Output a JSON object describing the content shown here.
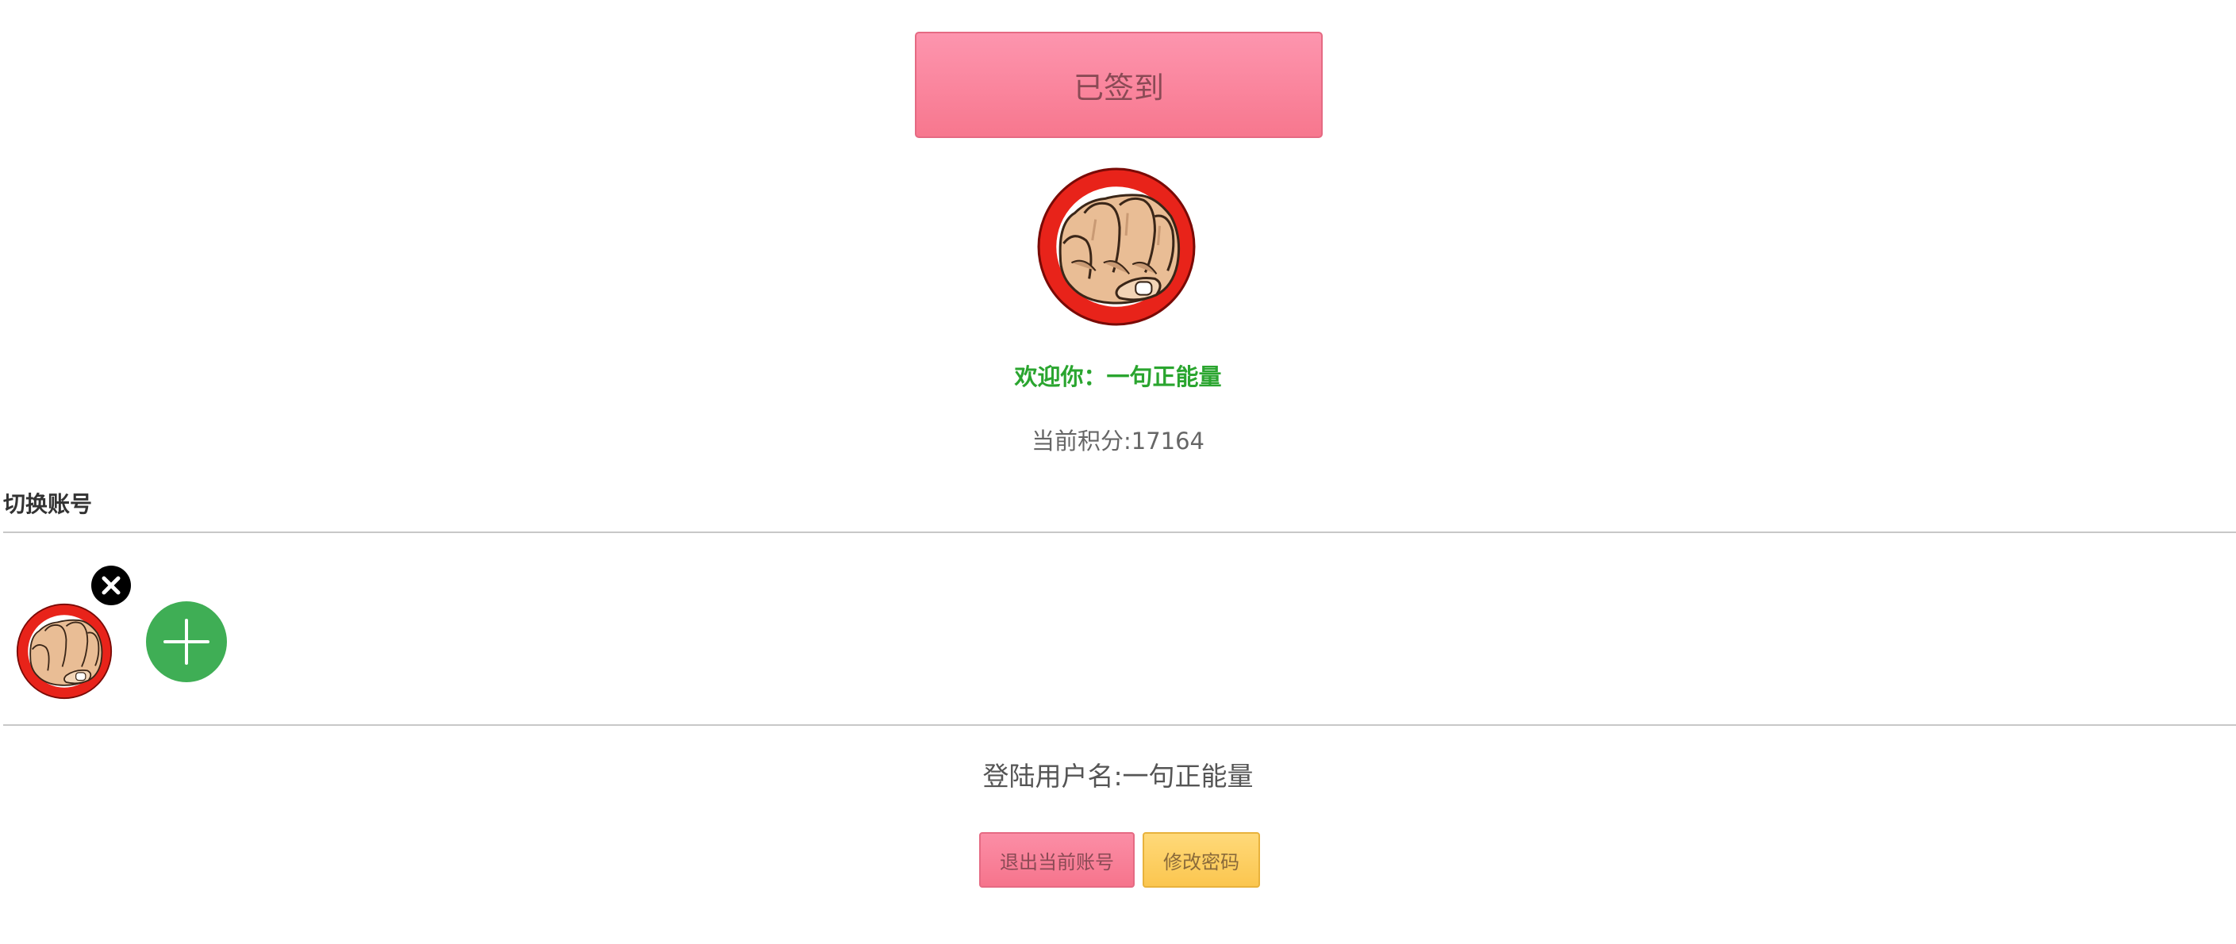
{
  "signin": {
    "label": "已签到"
  },
  "user": {
    "welcome": "欢迎你：一句正能量",
    "points": "当前积分:17164",
    "username": "登陆用户名:一句正能量",
    "avatar_icon": "fist-avatar-icon"
  },
  "switch_account": {
    "title": "切换账号",
    "remove_icon": "close-circle-icon",
    "add_icon": "plus-icon"
  },
  "actions": {
    "logout_label": "退出当前账号",
    "change_password_label": "修改密码"
  },
  "colors": {
    "signin_bg": "#f7778e",
    "welcome_text": "#2aa52f",
    "add_button": "#3fae55",
    "password_button": "#fbc64f",
    "avatar_ring": "#e8231a"
  }
}
